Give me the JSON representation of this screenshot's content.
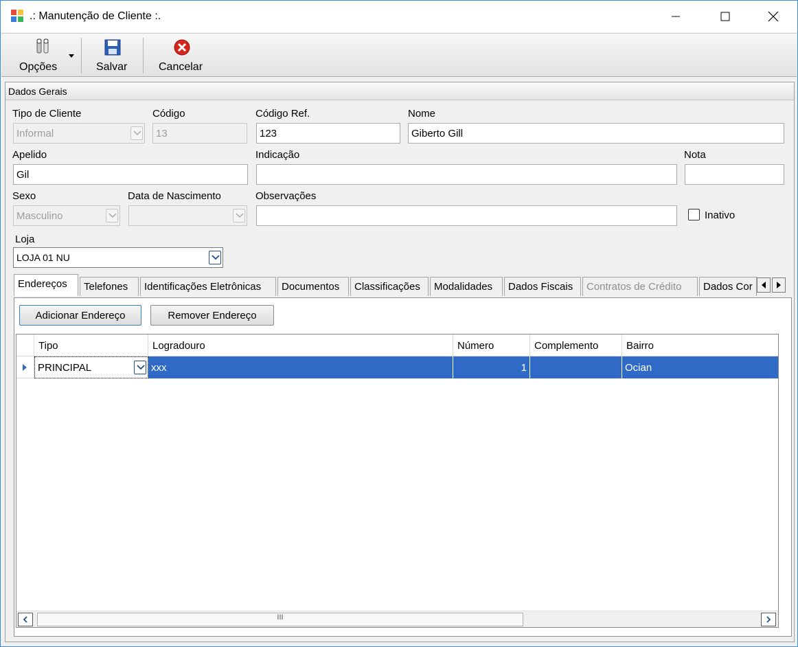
{
  "window": {
    "title": ".: Manutenção de Cliente :."
  },
  "toolbar": {
    "options_label": "Opções",
    "save_label": "Salvar",
    "cancel_label": "Cancelar"
  },
  "panel": {
    "title": "Dados Gerais"
  },
  "form": {
    "tipo_cliente": {
      "label": "Tipo de Cliente",
      "value": "Informal"
    },
    "codigo": {
      "label": "Código",
      "value": "13"
    },
    "codigo_ref": {
      "label": "Código Ref.",
      "value": "123"
    },
    "nome": {
      "label": "Nome",
      "value": "Giberto Gill"
    },
    "apelido": {
      "label": "Apelido",
      "value": "Gil"
    },
    "indicacao": {
      "label": "Indicação",
      "value": ""
    },
    "nota": {
      "label": "Nota",
      "value": ""
    },
    "sexo": {
      "label": "Sexo",
      "value": "Masculino"
    },
    "data_nascimento": {
      "label": "Data de Nascimento",
      "value": ""
    },
    "observacoes": {
      "label": "Observações",
      "value": ""
    },
    "inativo": {
      "label": "Inativo",
      "checked": false
    },
    "loja": {
      "label": "Loja",
      "value": "LOJA 01 NU"
    }
  },
  "tabs": [
    {
      "label": "Endereços",
      "active": true
    },
    {
      "label": "Telefones"
    },
    {
      "label": "Identificações Eletrônicas"
    },
    {
      "label": "Documentos"
    },
    {
      "label": "Classificações"
    },
    {
      "label": "Modalidades"
    },
    {
      "label": "Dados Fiscais"
    },
    {
      "label": "Contratos de Crédito",
      "disabled": true
    },
    {
      "label": "Dados Cor"
    }
  ],
  "address": {
    "add_button": "Adicionar Endereço",
    "remove_button": "Remover Endereço",
    "columns": [
      "Tipo",
      "Logradouro",
      "Número",
      "Complemento",
      "Bairro"
    ],
    "rows": [
      {
        "tipo": "PRINCIPAL",
        "logradouro": "xxx",
        "numero": "1",
        "complemento": "",
        "bairro": "Ocian"
      }
    ],
    "scroll_thumb": "III"
  }
}
